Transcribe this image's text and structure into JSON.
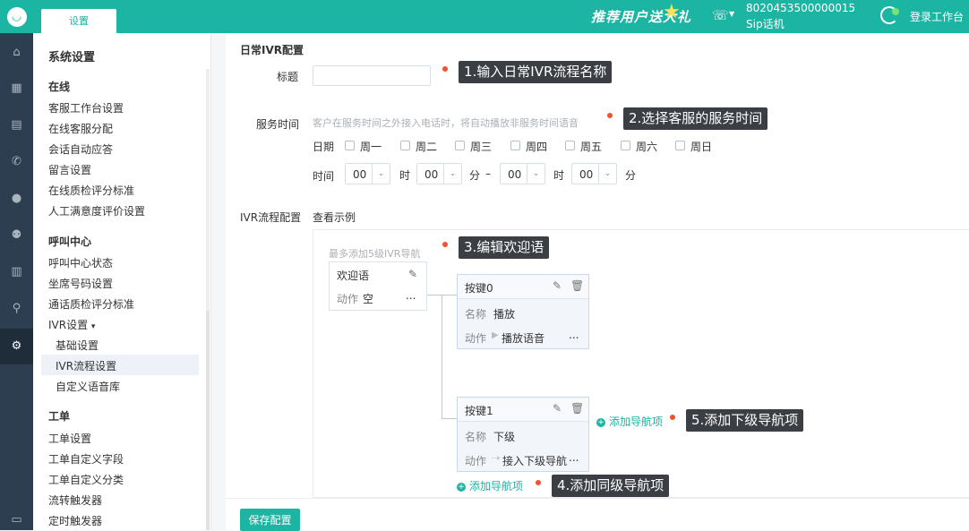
{
  "topbar": {
    "tab_label": "设置",
    "promo_text": "推荐用户送大礼",
    "sip_number": "8020453500000015",
    "sip_label": "Sip话机",
    "login_label": "登录工作台"
  },
  "iconbar": [
    "home-icon",
    "grid-icon",
    "book-icon",
    "phone-icon",
    "user-icon",
    "users-icon",
    "chart-icon",
    "search-icon",
    "gear-icon",
    "chat-icon"
  ],
  "sidebar": {
    "title": "系统设置",
    "groups": [
      {
        "label": "在线",
        "items": [
          "客服工作台设置",
          "在线客服分配",
          "会话自动应答",
          "留言设置",
          "在线质检评分标准",
          "人工满意度评价设置"
        ]
      },
      {
        "label": "呼叫中心",
        "items": [
          "呼叫中心状态",
          "坐席号码设置",
          "通话质检评分标准",
          "IVR设置"
        ]
      },
      {
        "label": "工单",
        "items": [
          "工单设置",
          "工单自定义字段",
          "工单自定义分类",
          "流转触发器",
          "定时触发器"
        ]
      }
    ],
    "ivr_sub": [
      "基础设置",
      "IVR流程设置",
      "自定义语音库"
    ],
    "ivr_caret": "▾"
  },
  "form": {
    "section_title": "日常IVR配置",
    "title_label": "标题",
    "title_value": "",
    "service_time_label": "服务时间",
    "service_hint": "客户在服务时间之外接入电话时，将自动播放非服务时间语音",
    "date_label": "日期",
    "weekdays": [
      "周一",
      "周二",
      "周三",
      "周四",
      "周五",
      "周六",
      "周日"
    ],
    "time_label": "时间",
    "hour_unit": "时",
    "minute_unit": "分",
    "dash": "–",
    "start_hour": "00",
    "start_minute": "00",
    "end_hour": "00",
    "end_minute": "00",
    "ivr_flow_label": "IVR流程配置",
    "view_example": "查看示例"
  },
  "flow": {
    "max_hint": "最多添加5级IVR导航",
    "welcome_title": "欢迎语",
    "welcome_action_label": "动作",
    "welcome_action_value": "空",
    "ellipsis": "...",
    "keys": [
      {
        "title": "按键0",
        "name_label": "名称",
        "name_value": "播放",
        "action_label": "动作",
        "action_value": "播放语音",
        "action_icon": "▶"
      },
      {
        "title": "按键1",
        "name_label": "名称",
        "name_value": "下级",
        "action_label": "动作",
        "action_value": "接入下级导航",
        "action_icon": "⇢"
      }
    ],
    "add_nav": "添加导航项",
    "plus": "+"
  },
  "footer": {
    "save_label": "保存配置"
  },
  "annotations": [
    "1.输入日常IVR流程名称",
    "2.选择客服的服务时间",
    "3.编辑欢迎语",
    "4.添加同级导航项",
    "5.添加下级导航项"
  ],
  "colors": {
    "brand": "#1cb5a3",
    "annotation_dot": "#f0532c",
    "annotation_bg": "#3b3f44"
  }
}
